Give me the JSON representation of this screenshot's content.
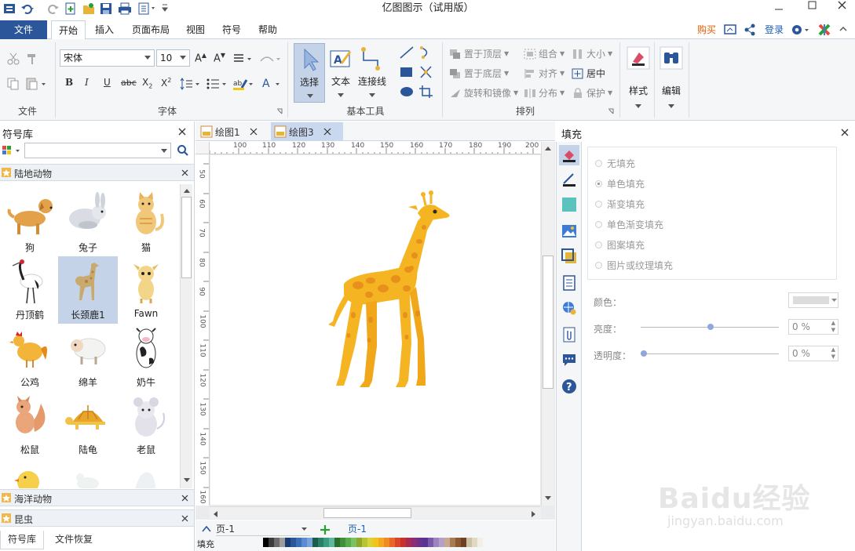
{
  "app": {
    "title": "亿图图示（试用版）"
  },
  "ribbon_tabs": {
    "file": "文件",
    "home": "开始",
    "insert": "插入",
    "page_layout": "页面布局",
    "view": "视图",
    "symbol": "符号",
    "help": "帮助"
  },
  "header_right": {
    "buy": "购买",
    "login": "登录"
  },
  "font": {
    "family": "宋体",
    "size": "10"
  },
  "groups": {
    "file": "文件",
    "font": "字体",
    "basic_tools": "基本工具",
    "arrange": "排列"
  },
  "tools": {
    "select": "选择",
    "text": "文本",
    "connector": "连接线",
    "style": "样式",
    "edit": "编辑"
  },
  "arrange": {
    "bring_front": "置于顶层",
    "send_back": "置于底层",
    "rotate_mirror": "旋转和镜像",
    "group": "组合",
    "align": "对齐",
    "distribute": "分布",
    "size": "大小",
    "center": "居中",
    "protect": "保护"
  },
  "symbol_panel": {
    "title": "符号库",
    "category": "陆地动物",
    "category2": "海洋动物",
    "category3": "昆虫",
    "tab1": "符号库",
    "tab2": "文件恢复"
  },
  "symbols": [
    "狗",
    "兔子",
    "猫",
    "丹顶鹤",
    "长颈鹿1",
    "Fawn",
    "公鸡",
    "绵羊",
    "奶牛",
    "松鼠",
    "陆龟",
    "老鼠"
  ],
  "doc_tabs": {
    "tab1": "绘图1",
    "tab2": "绘图3"
  },
  "ruler": {
    "h": [
      "100",
      "110",
      "120",
      "130",
      "140",
      "150",
      "160",
      "170",
      "180",
      "190",
      "200"
    ],
    "v": [
      "50",
      "60",
      "70",
      "80",
      "90",
      "100",
      "110",
      "120",
      "130",
      "140",
      "150",
      "160"
    ]
  },
  "page_bar": {
    "page_select": "页-1",
    "page_tab": "页-1",
    "fill_label": "填充"
  },
  "fill_panel": {
    "title": "填充",
    "options": [
      "无填充",
      "单色填充",
      "渐变填充",
      "单色渐变填充",
      "图案填充",
      "图片或纹理填充"
    ],
    "color_label": "颜色：",
    "brightness_label": "亮度：",
    "brightness_value": "0 %",
    "transparency_label": "透明度：",
    "transparency_value": "0 %"
  },
  "watermark": {
    "brand": "Baidu经验",
    "url": "jingyan.baidu.com"
  },
  "colors": {
    "accent": "#2b579a",
    "file_tab": "#2b579a",
    "buy": "#e05a00",
    "login": "#1f5fb4",
    "selected_cell": "#c5d3e8",
    "giraffe": "#f5b422",
    "giraffe_spot": "#e58a1a"
  },
  "palette": [
    "#000000",
    "#3c3c3c",
    "#6b6b6b",
    "#9c9c9c",
    "#1b3c73",
    "#2b579a",
    "#3d6fb8",
    "#5b8bd0",
    "#7aa3dd",
    "#1c5c4b",
    "#2a7f68",
    "#3b9c82",
    "#5fb89e",
    "#2c6e2c",
    "#3e8f3e",
    "#5aac4a",
    "#7cc263",
    "#8ea82a",
    "#b8c433",
    "#d9d23a",
    "#f0c419",
    "#f5a623",
    "#f08a24",
    "#e5682a",
    "#d9472b",
    "#c8302c",
    "#a82a52",
    "#8c2d74",
    "#6b3089",
    "#55358f",
    "#7a5aa6",
    "#9d83bf",
    "#b3a1c8",
    "#c9a98d",
    "#a87b55",
    "#8b5a33",
    "#6e4125",
    "#ccc2a6",
    "#e0dac4",
    "#f3efe2"
  ]
}
